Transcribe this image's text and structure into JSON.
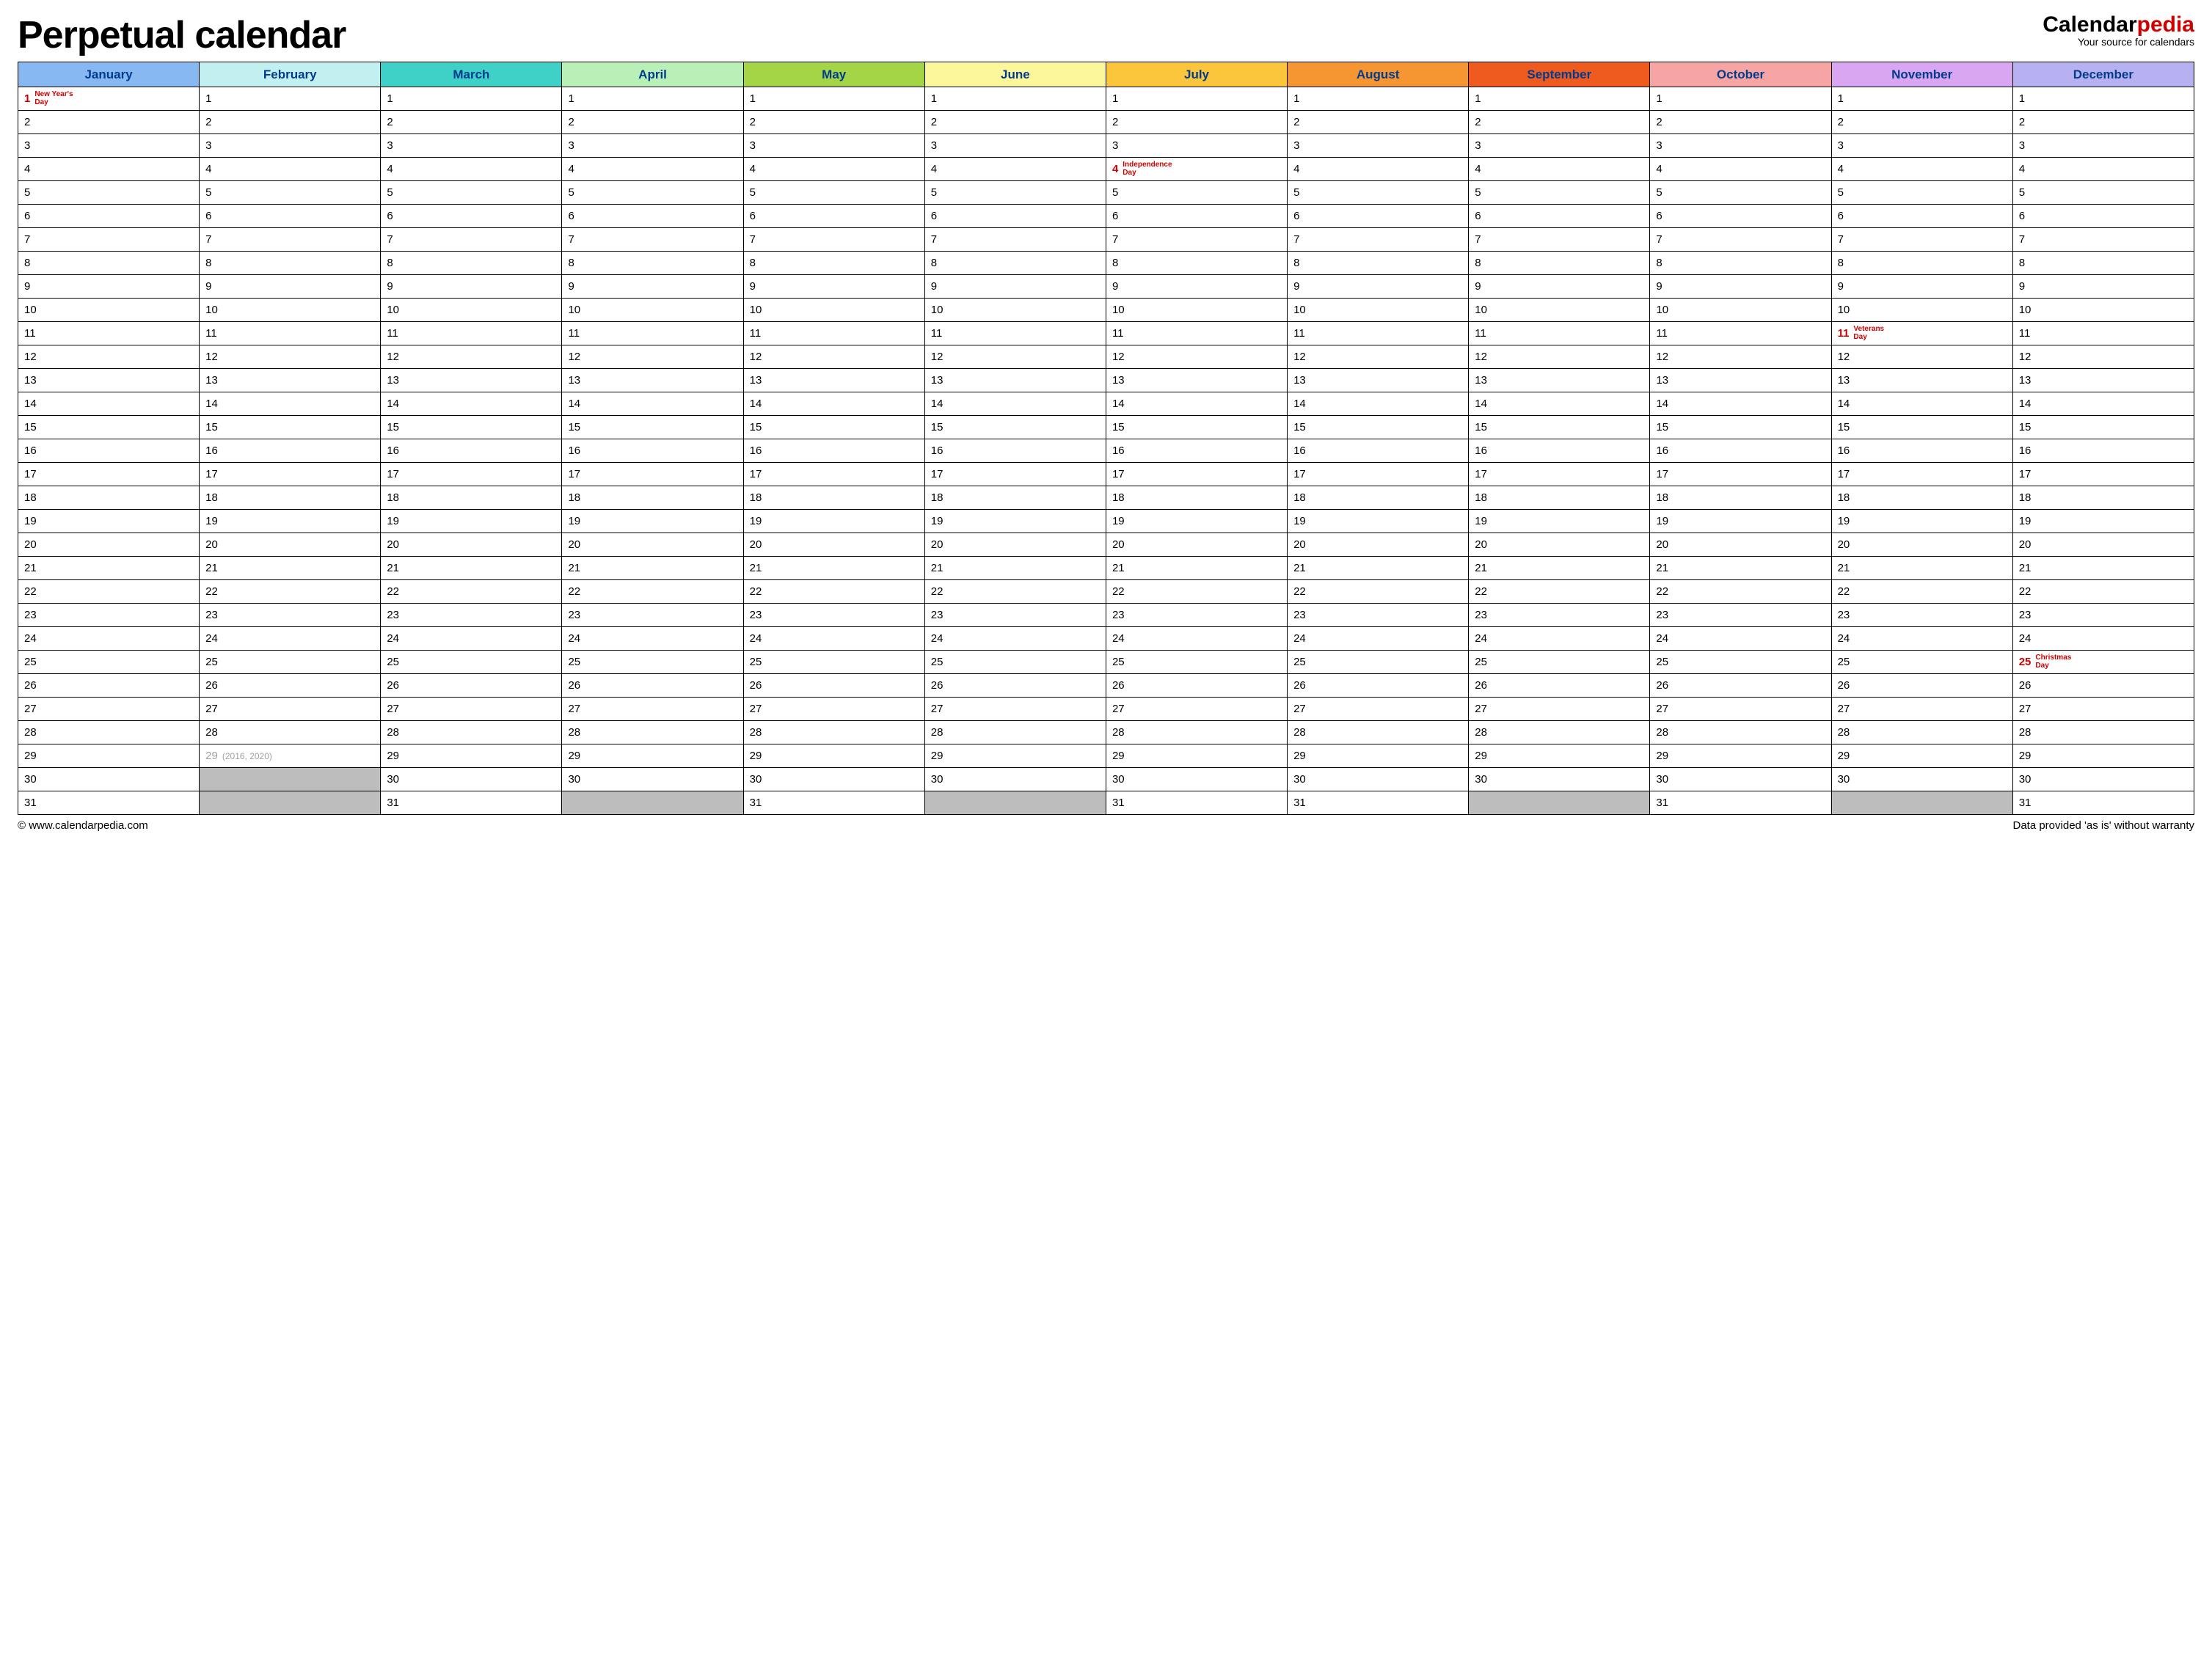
{
  "header": {
    "title": "Perpetual calendar",
    "brand_prefix": "Calendar",
    "brand_accent": "pedia",
    "brand_sub": "Your source for calendars"
  },
  "months": [
    {
      "name": "January",
      "color": "#87b8f2",
      "days": 31
    },
    {
      "name": "February",
      "color": "#c2f0f0",
      "days": 29
    },
    {
      "name": "March",
      "color": "#3fd1c8",
      "days": 31
    },
    {
      "name": "April",
      "color": "#b9f0b8",
      "days": 30
    },
    {
      "name": "May",
      "color": "#a3d546",
      "days": 31
    },
    {
      "name": "June",
      "color": "#fdf79b",
      "days": 30
    },
    {
      "name": "July",
      "color": "#fbc53c",
      "days": 31
    },
    {
      "name": "August",
      "color": "#f59633",
      "days": 31
    },
    {
      "name": "September",
      "color": "#ef5a1e",
      "days": 30
    },
    {
      "name": "October",
      "color": "#f6a4a4",
      "days": 31
    },
    {
      "name": "November",
      "color": "#d9a6f2",
      "days": 30
    },
    {
      "name": "December",
      "color": "#b7b1f2",
      "days": 31
    }
  ],
  "max_rows": 31,
  "holidays": [
    {
      "month": 0,
      "day": 1,
      "label": "New Year's Day"
    },
    {
      "month": 6,
      "day": 4,
      "label": "Independence Day"
    },
    {
      "month": 10,
      "day": 11,
      "label": "Veterans Day"
    },
    {
      "month": 11,
      "day": 25,
      "label": "Christmas Day"
    }
  ],
  "leap_note": {
    "month": 1,
    "day": 29,
    "text": "(2016, 2020)"
  },
  "footer": {
    "left": "© www.calendarpedia.com",
    "right": "Data provided 'as is' without warranty"
  }
}
